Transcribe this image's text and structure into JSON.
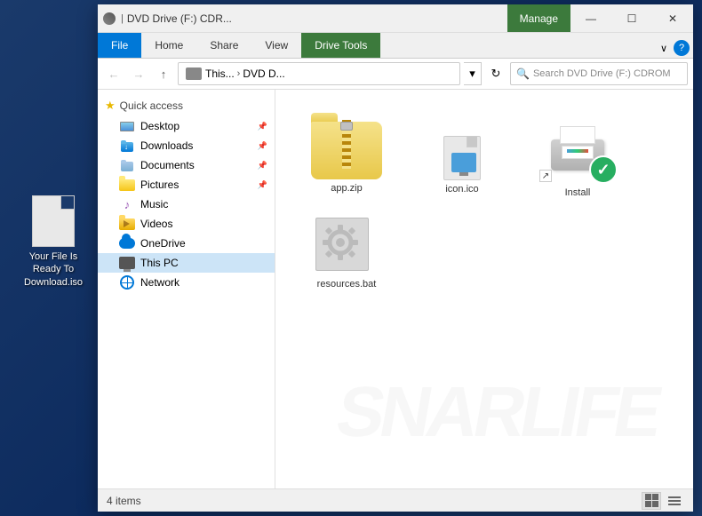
{
  "desktop": {
    "background": "#1a3a6b"
  },
  "desktop_icon": {
    "label": "Your File Is Ready To Download.iso"
  },
  "window": {
    "title": "DVD Drive (F:) CDR...",
    "title_full": "DVD Drive (F:) CDROM",
    "manage_label": "Manage"
  },
  "window_controls": {
    "minimize": "—",
    "maximize": "☐",
    "close": "✕"
  },
  "ribbon": {
    "tabs": [
      "File",
      "Home",
      "Share",
      "View",
      "Drive Tools"
    ],
    "active_tab": "Drive Tools",
    "chevron": "∨",
    "help": "?"
  },
  "address_bar": {
    "path_parts": [
      "This...",
      "DVD D..."
    ],
    "search_placeholder": "Search DVD Drive (F:) CDROM"
  },
  "nav_pane": {
    "quick_access_label": "Quick access",
    "items": [
      {
        "label": "Desktop",
        "type": "desktop"
      },
      {
        "label": "Downloads",
        "type": "downloads"
      },
      {
        "label": "Documents",
        "type": "documents"
      },
      {
        "label": "Pictures",
        "type": "pictures"
      },
      {
        "label": "Music",
        "type": "music"
      },
      {
        "label": "Videos",
        "type": "videos"
      },
      {
        "label": "OneDrive",
        "type": "onedrive"
      },
      {
        "label": "This PC",
        "type": "pc"
      },
      {
        "label": "Network",
        "type": "network"
      }
    ]
  },
  "files": [
    {
      "name": "app.zip",
      "type": "zip"
    },
    {
      "name": "icon.ico",
      "type": "ico"
    },
    {
      "name": "Install",
      "type": "install"
    },
    {
      "name": "resources.bat",
      "type": "bat"
    }
  ],
  "status_bar": {
    "item_count": "4 items"
  },
  "watermark": "SNARLIFE"
}
